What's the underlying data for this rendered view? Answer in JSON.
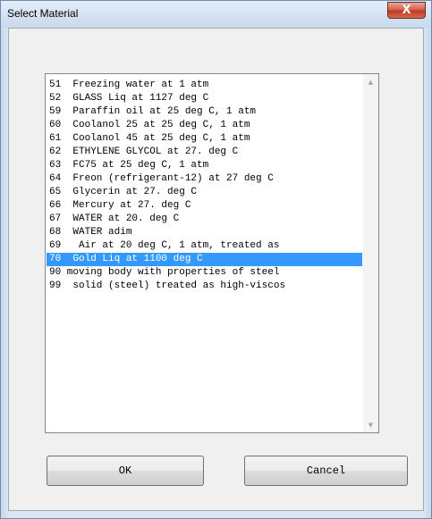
{
  "window": {
    "title": "Select Material",
    "close_glyph": "X"
  },
  "materials": [
    "51  Freezing water at 1 atm",
    "52  GLASS Liq at 1127 deg C",
    "59  Paraffin oil at 25 deg C, 1 atm",
    "60  Coolanol 25 at 25 deg C, 1 atm",
    "61  Coolanol 45 at 25 deg C, 1 atm",
    "62  ETHYLENE GLYCOL at 27. deg C",
    "63  FC75 at 25 deg C, 1 atm",
    "64  Freon (refrigerant-12) at 27 deg C",
    "65  Glycerin at 27. deg C",
    "66  Mercury at 27. deg C",
    "67  WATER at 20. deg C",
    "68  WATER adim",
    "69   Air at 20 deg C, 1 atm, treated as",
    "70  Gold Liq at 1100 deg C",
    "90 moving body with properties of steel",
    "99  solid (steel) treated as high-viscos"
  ],
  "selected_index": 13,
  "scrollbar": {
    "up_icon": "scroll-up-arrow",
    "down_icon": "scroll-down-arrow"
  },
  "buttons": {
    "ok_label": "OK",
    "cancel_label": "Cancel"
  }
}
